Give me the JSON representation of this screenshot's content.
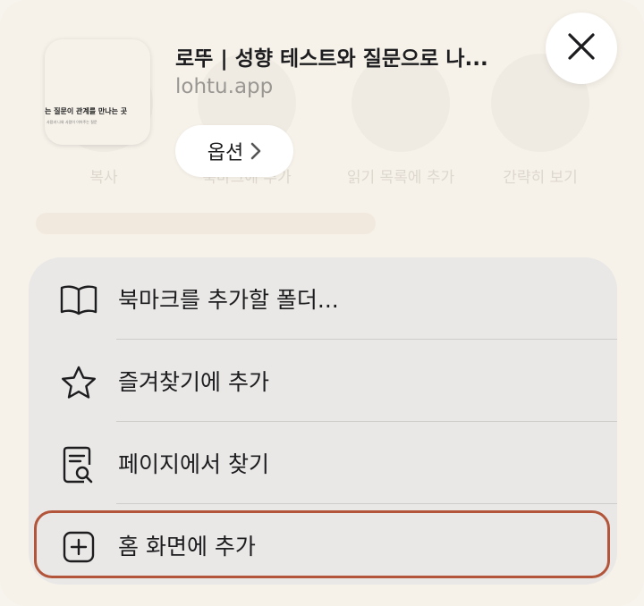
{
  "background_actions": [
    {
      "label": "복사",
      "icon": "copy-icon"
    },
    {
      "label": "북마크에 추가",
      "icon": "book-icon"
    },
    {
      "label": "읽기 목록에 추가",
      "icon": "glasses-icon"
    },
    {
      "label": "간략히 보기",
      "icon": "chevron-up-icon"
    }
  ],
  "header": {
    "site_title": "로뚜 | 성향 테스트와 질문으로 나...",
    "site_url": "lohtu.app",
    "thumb_line1": "는 질문이 관계를 만나는 곳",
    "thumb_line2": "사람과 나와 사람이 이어주는 질문",
    "options_label": "옵션"
  },
  "menu": {
    "items": [
      {
        "label": "북마크를 추가할 폴더...",
        "icon": "book-open-icon"
      },
      {
        "label": "즐겨찾기에 추가",
        "icon": "star-icon"
      },
      {
        "label": "페이지에서 찾기",
        "icon": "find-in-page-icon"
      },
      {
        "label": "홈 화면에 추가",
        "icon": "plus-square-icon"
      }
    ]
  },
  "colors": {
    "highlight": "#b3553a",
    "sheet_bg": "#f6f2ea",
    "menu_bg": "#e9e8e6"
  }
}
